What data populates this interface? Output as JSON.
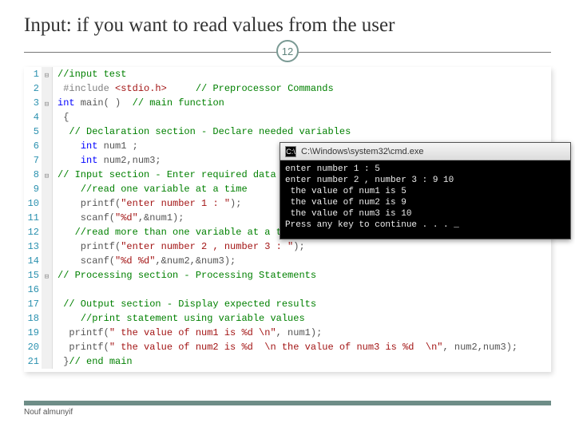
{
  "title": "Input: if you want to read values from the user",
  "page_number": "12",
  "author": "Nouf almunyif",
  "code": {
    "lines": [
      {
        "n": 1,
        "gutter": "⊟",
        "html": "<span class='cm'>//input test</span>"
      },
      {
        "n": 2,
        "gutter": "",
        "html": " <span class='pp'>#include</span> <span class='st'>&lt;stdio.h&gt;</span>     <span class='cm'>// Preprocessor Commands</span>"
      },
      {
        "n": 3,
        "gutter": "⊟",
        "html": "<span class='kw'>int</span> main( )  <span class='cm'>// main function</span>"
      },
      {
        "n": 4,
        "gutter": "",
        "html": " {"
      },
      {
        "n": 5,
        "gutter": "",
        "html": "  <span class='cm'>// Declaration section - Declare needed variables</span>"
      },
      {
        "n": 6,
        "gutter": "",
        "html": "    <span class='kw'>int</span> num1 ;"
      },
      {
        "n": 7,
        "gutter": "",
        "html": "    <span class='kw'>int</span> num2,num3;"
      },
      {
        "n": 8,
        "gutter": "⊟",
        "html": "<span class='cm'>// Input section - Enter required data</span>"
      },
      {
        "n": 9,
        "gutter": "",
        "html": "    <span class='cm'>//read one variable at a time</span>"
      },
      {
        "n": 10,
        "gutter": "",
        "html": "    printf(<span class='st'>\"enter number 1 : \"</span>);"
      },
      {
        "n": 11,
        "gutter": "",
        "html": "    scanf(<span class='st'>\"%d\"</span>,&amp;num1);"
      },
      {
        "n": 12,
        "gutter": "",
        "html": "   <span class='cm'>//read more than one variable at a time</span>"
      },
      {
        "n": 13,
        "gutter": "",
        "html": "    printf(<span class='st'>\"enter number 2 , number 3 : \"</span>);"
      },
      {
        "n": 14,
        "gutter": "",
        "html": "    scanf(<span class='st'>\"%d %d\"</span>,&amp;num2,&amp;num3);"
      },
      {
        "n": 15,
        "gutter": "⊟",
        "html": "<span class='cm'>// Processing section - Processing Statements</span>"
      },
      {
        "n": 16,
        "gutter": "",
        "html": ""
      },
      {
        "n": 17,
        "gutter": "",
        "html": " <span class='cm'>// Output section - Display expected results</span>"
      },
      {
        "n": 18,
        "gutter": "",
        "html": "    <span class='cm'>//print statement using variable values</span>"
      },
      {
        "n": 19,
        "gutter": "",
        "html": "  printf(<span class='st'>\" the value of num1 is %d \\n\"</span>, num1);"
      },
      {
        "n": 20,
        "gutter": "",
        "html": "  printf(<span class='st'>\" the value of num2 is %d  \\n the value of num3 is %d  \\n\"</span>, num2,num3);"
      },
      {
        "n": 21,
        "gutter": "",
        "html": " }<span class='cm'>// end main</span>"
      }
    ]
  },
  "console": {
    "title_path": "C:\\Windows\\system32\\cmd.exe",
    "icon_glyph": "C:\\",
    "output": "enter number 1 : 5\nenter number 2 , number 3 : 9 10\n the value of num1 is 5\n the value of num2 is 9\n the value of num3 is 10\nPress any key to continue . . . _"
  }
}
